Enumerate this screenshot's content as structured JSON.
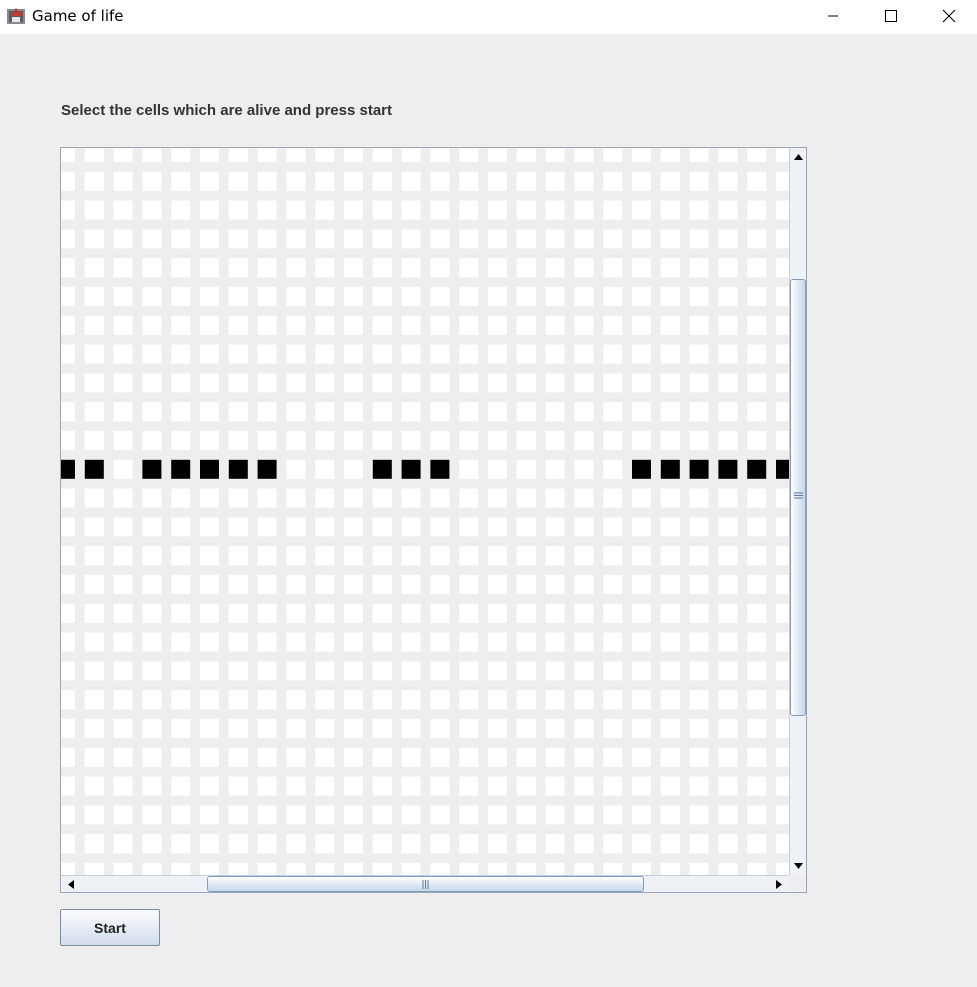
{
  "window": {
    "title": "Game of life",
    "icon": "java-app-icon",
    "controls": [
      "minimize-icon",
      "maximize-icon",
      "close-icon"
    ]
  },
  "instruction": "Select the cells which are alive and press start",
  "grid": {
    "visible_columns": 26,
    "visible_rows": 26,
    "alive_row": 11,
    "alive_columns": [
      0,
      1,
      3,
      4,
      5,
      6,
      7,
      11,
      12,
      13,
      20,
      21,
      22,
      23,
      24,
      25
    ],
    "colors": {
      "dead": "#ffffff",
      "alive": "#000000",
      "gap": "#eeeeee"
    }
  },
  "scrollbars": {
    "vertical": {
      "up_icon": "arrow-up-icon",
      "down_icon": "arrow-down-icon"
    },
    "horizontal": {
      "left_icon": "arrow-left-icon",
      "right_icon": "arrow-right-icon"
    }
  },
  "start_button": {
    "label": "Start"
  }
}
